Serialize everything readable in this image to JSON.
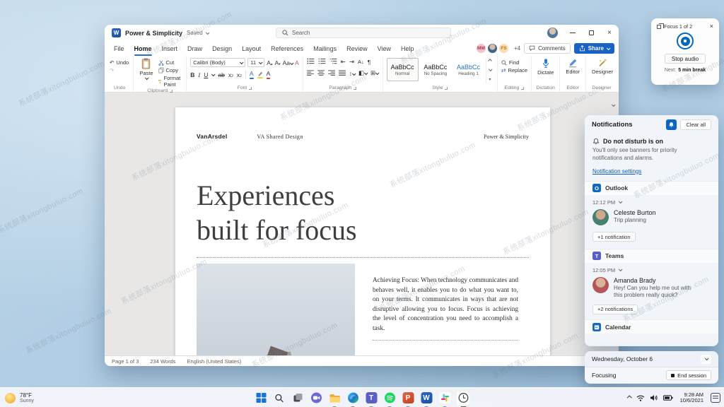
{
  "watermark_text": "系统部落xitongbuluo.com",
  "colors": {
    "word_blue": "#185abd",
    "accent_blue": "#0067c0",
    "heading_style_blue": "#2e74b5",
    "link_blue": "#0a5dc2"
  },
  "icons": {
    "word_logo": "W",
    "powerpoint_logo": "P",
    "teams_logo": "T",
    "outlook_logo": "O",
    "close": "×",
    "undo": "↶",
    "redo": "↷",
    "pilcrow": "¶",
    "bold": "B",
    "italic": "I",
    "underline": "U",
    "strikethrough": "ab",
    "subscript_x": "x",
    "superscript_x": "x",
    "sub2": "2",
    "sup2": "2",
    "letter_a": "A",
    "change_case": "Aa",
    "sort_az": "A↓",
    "indent_left": "⇤",
    "indent_right": "⇥",
    "line_spacing": "↕",
    "borders": "⊞",
    "shading": "◧",
    "replace": "⇄",
    "caret_up": "▴",
    "caret_down": "▾"
  },
  "word": {
    "titlebar": {
      "title": "Power & Simplicity",
      "save_status": "Saved",
      "search_placeholder": "Search"
    },
    "tabs": {
      "items": [
        "File",
        "Home",
        "Insert",
        "Draw",
        "Design",
        "Layout",
        "References",
        "Mailings",
        "Review",
        "View",
        "Help"
      ],
      "active": "Home"
    },
    "collab": {
      "avatar1": "MM",
      "avatar3": "FS",
      "overflow": "+4",
      "comments_label": "Comments",
      "share_label": "Share"
    },
    "ribbon": {
      "undo": {
        "undo_label": "Undo",
        "group_label": "Undo"
      },
      "clipboard": {
        "paste_label": "Paste",
        "cut_label": "Cut",
        "copy_label": "Copy",
        "format_painter_label": "Format Paint",
        "group_label": "Clipboard"
      },
      "font": {
        "font_name": "Calibri (Body)",
        "font_size": "11",
        "group_label": "Font"
      },
      "paragraph": {
        "group_label": "Paragraph"
      },
      "style": {
        "sample": "AaBbCc",
        "style1": "Normal",
        "style2": "No Spacing",
        "style3": "Heading 1",
        "group_label": "Style"
      },
      "editing": {
        "find_label": "Find",
        "replace_label": "Replace",
        "group_label": "Editing"
      },
      "dictation": {
        "dictate_label": "Dictate",
        "group_label": "Dictation"
      },
      "editor": {
        "editor_label": "Editor",
        "group_label": "Editor"
      },
      "designer": {
        "designer_label": "Designer",
        "group_label": "Designer"
      }
    },
    "document": {
      "brand": "VanArsdel",
      "header_center": "VA Shared Design",
      "header_right": "Power & Simplicity",
      "title_line1": "Experiences",
      "title_line2": "built for focus",
      "body_paragraph": "Achieving Focus: When technology communicates and behaves well, it enables you to do what you want to, on your terms. It communicates in ways that are not disruptive allowing you to focus. Focus is achieving the level of concentration you need to accomplish a task."
    },
    "statusbar": {
      "page_info": "Page 1 of 3",
      "word_count": "234 Words",
      "language": "English (United States)"
    }
  },
  "focus_widget": {
    "title": "Focus 1 of 2",
    "stop_button": "Stop audio",
    "next_label": "Next:",
    "next_value": "5 min break"
  },
  "notifications": {
    "title": "Notifications",
    "clear_all": "Clear all",
    "dnd_title": "Do not disturb is on",
    "dnd_description": "You'll only see banners for priority notifications and alarms.",
    "settings_link": "Notification settings",
    "outlook": {
      "app": "Outlook",
      "time": "12:12 PM",
      "sender": "Celeste Burton",
      "message": "Trip planning",
      "more": "+1 notification"
    },
    "teams": {
      "app": "Teams",
      "time": "12:05 PM",
      "sender": "Amanda Brady",
      "message": "Hey! Can you help me out with this problem really quick?",
      "more": "+2 notifications"
    },
    "calendar": {
      "app": "Calendar"
    }
  },
  "calendar_card": {
    "date": "Wednesday, October 6",
    "status": "Focusing",
    "end_session": "End session"
  },
  "taskbar": {
    "weather": {
      "temperature": "78°F",
      "condition": "Sunny"
    },
    "tray": {
      "time": "9:28 AM",
      "date": "10/6/2021"
    }
  }
}
